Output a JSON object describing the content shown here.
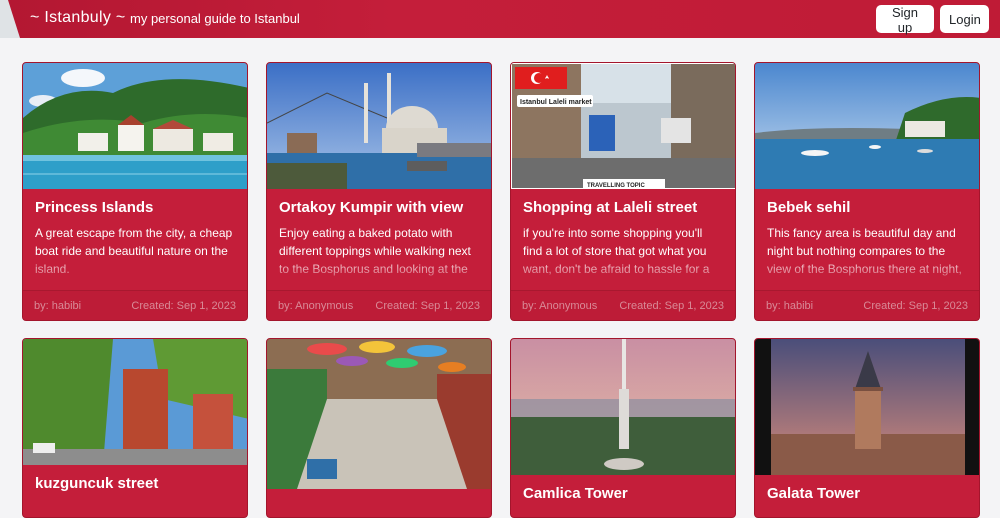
{
  "nav": {
    "brand": "~ Istanbuly ~",
    "tagline": "my personal guide to Istanbul",
    "signup_label": "Sign up",
    "login_label": "Login"
  },
  "cards": [
    {
      "title": "Princess Islands",
      "description": "A great escape from the city, a cheap boat ride and beautiful nature on the island.",
      "author": "by: habibi",
      "created": "Created: Sep 1, 2023"
    },
    {
      "title": "Ortakoy Kumpir with view",
      "description": "Enjoy eating a baked potato with different toppings while walking next to the Bosphorus and looking at the beautiful view",
      "author": "by: Anonymous",
      "created": "Created: Sep 1, 2023"
    },
    {
      "title": "Shopping at Laleli street",
      "description": "if you're into some shopping you'll find a lot of store that got what you want, don't be afraid to hassle for a better price",
      "author": "by: Anonymous",
      "created": "Created: Sep 1, 2023",
      "image_caption": "Istanbul Laleli market",
      "image_watermark": "TRAVELLING TOPIC"
    },
    {
      "title": "Bebek sehil",
      "description": "This fancy area is beautiful day and night but nothing compares to the view of the Bosphorus there at night, there's many restaurants and bars too",
      "author": "by: habibi",
      "created": "Created: Sep 1, 2023"
    },
    {
      "title": "kuzguncuk street"
    },
    {
      "title": ""
    },
    {
      "title": "Camlica Tower"
    },
    {
      "title": "Galata Tower"
    }
  ],
  "colors": {
    "primary": "#c41e3a",
    "background": "#f4f4f6",
    "footer_text": "#d98a97"
  }
}
